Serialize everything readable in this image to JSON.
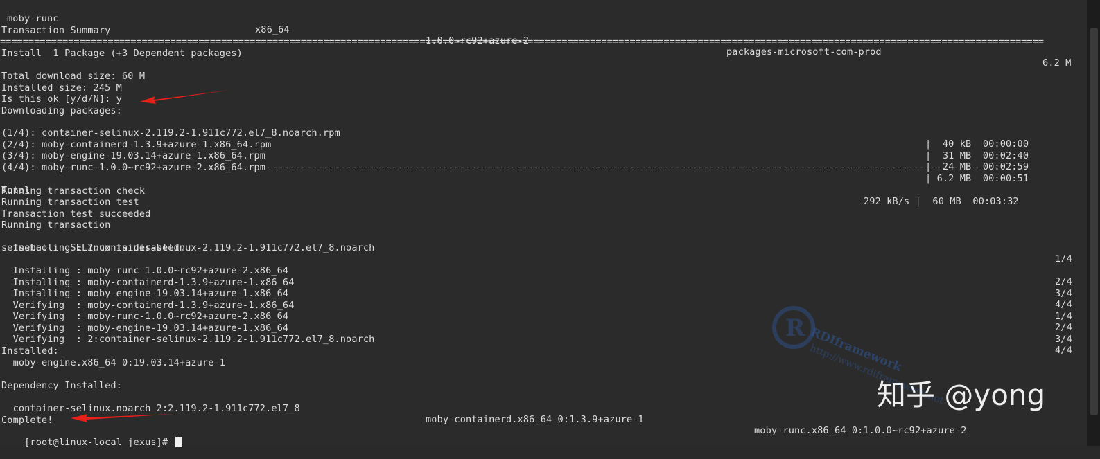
{
  "header_row": {
    "name": "moby-runc",
    "arch": "x86_64",
    "version": "1.0.0~rc92+azure-2",
    "repo": "packages-microsoft-com-prod",
    "size": "6.2 M"
  },
  "summary_title": "Transaction Summary",
  "separator_double": "========================================================================================================================================================================================",
  "install_line": "Install  1 Package (+3 Dependent packages)",
  "total_download": "Total download size: 60 M",
  "installed_size": "Installed size: 245 M",
  "prompt_ok": "Is this ok [y/d/N]: y",
  "downloading": "Downloading packages:",
  "downloads": [
    {
      "name": "(1/4): container-selinux-2.119.2-1.911c772.el7_8.noarch.rpm",
      "size": "|  40 kB  00:00:00"
    },
    {
      "name": "(2/4): moby-containerd-1.3.9+azure-1.x86_64.rpm",
      "size": "|  31 MB  00:02:40"
    },
    {
      "name": "(3/4): moby-engine-19.03.14+azure-1.x86_64.rpm",
      "size": "|  24 MB  00:02:59"
    },
    {
      "name": "(4/4): moby-runc-1.0.0~rc92+azure-2.x86_64.rpm",
      "size": "| 6.2 MB  00:00:51"
    }
  ],
  "separator_dash": "--------------------------------------------------------------------------------------------------------------------------------------------------------------------------------",
  "total": {
    "label": "Total",
    "rate": "292 kB/s |  60 MB  00:03:32"
  },
  "running": [
    "Running transaction check",
    "Running transaction test",
    "Transaction test succeeded",
    "Running transaction"
  ],
  "steps_a": [
    {
      "text": "  Installing : 2:container-selinux-2.119.2-1.911c772.el7_8.noarch",
      "count": "1/4"
    }
  ],
  "setsebool": "setsebool:  SELinux is disabled.",
  "steps_b": [
    {
      "text": "  Installing : moby-runc-1.0.0~rc92+azure-2.x86_64",
      "count": "2/4"
    },
    {
      "text": "  Installing : moby-containerd-1.3.9+azure-1.x86_64",
      "count": "3/4"
    },
    {
      "text": "  Installing : moby-engine-19.03.14+azure-1.x86_64",
      "count": "4/4"
    },
    {
      "text": "  Verifying  : moby-containerd-1.3.9+azure-1.x86_64",
      "count": "1/4"
    },
    {
      "text": "  Verifying  : moby-runc-1.0.0~rc92+azure-2.x86_64",
      "count": "2/4"
    },
    {
      "text": "  Verifying  : moby-engine-19.03.14+azure-1.x86_64",
      "count": "3/4"
    },
    {
      "text": "  Verifying  : 2:container-selinux-2.119.2-1.911c772.el7_8.noarch",
      "count": "4/4"
    }
  ],
  "installed_label": "Installed:",
  "installed_pkg": "  moby-engine.x86_64 0:19.03.14+azure-1",
  "dep_label": "Dependency Installed:",
  "deps": [
    "  container-selinux.noarch 2:2.119.2-1.911c772.el7_8",
    "moby-containerd.x86_64 0:1.3.9+azure-1",
    "moby-runc.x86_64 0:1.0.0~rc92+azure-2"
  ],
  "complete": "Complete!",
  "prompt": "[root@linux-local jexus]# ",
  "watermark": {
    "brand": "RDIframework",
    "url": "http://www.rdiframework.net",
    "zhihu": "知乎 @yong"
  },
  "colors": {
    "background": "#2b2b2b",
    "text": "#dcdcdc",
    "arrow": "#e8201a"
  }
}
